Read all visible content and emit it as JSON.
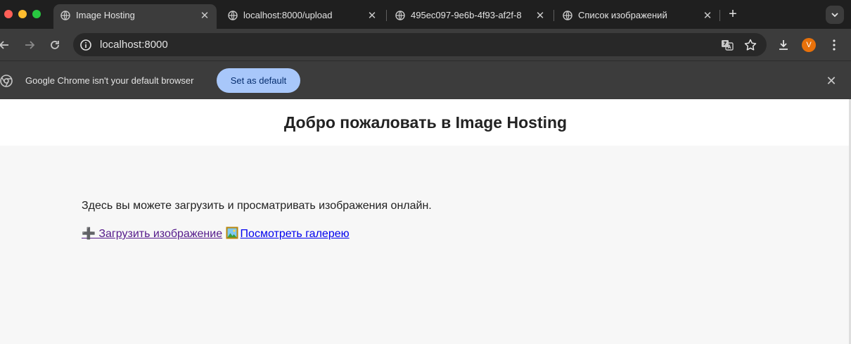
{
  "tabs": [
    {
      "title": "Image Hosting",
      "active": true
    },
    {
      "title": "localhost:8000/upload",
      "active": false
    },
    {
      "title": "495ec097-9e6b-4f93-af2f-8",
      "active": false
    },
    {
      "title": "Список изображений",
      "active": false
    }
  ],
  "toolbar": {
    "url": "localhost:8000",
    "avatar_letter": "V"
  },
  "infobar": {
    "message": "Google Chrome isn't your default browser",
    "button_label": "Set as default"
  },
  "page": {
    "heading": "Добро пожаловать в Image Hosting",
    "intro": "Здесь вы можете загрузить и просматривать изображения онлайн.",
    "upload_link": "➕ Загрузить изображение",
    "gallery_link": "Посмотреть галерею"
  },
  "colors": {
    "tab_strip": "#1f1f1f",
    "toolbar": "#3c3c3c",
    "accent_button": "#a8c7fa",
    "avatar": "#e8710a",
    "visited_link": "#551a8b",
    "link": "#0000ee"
  }
}
